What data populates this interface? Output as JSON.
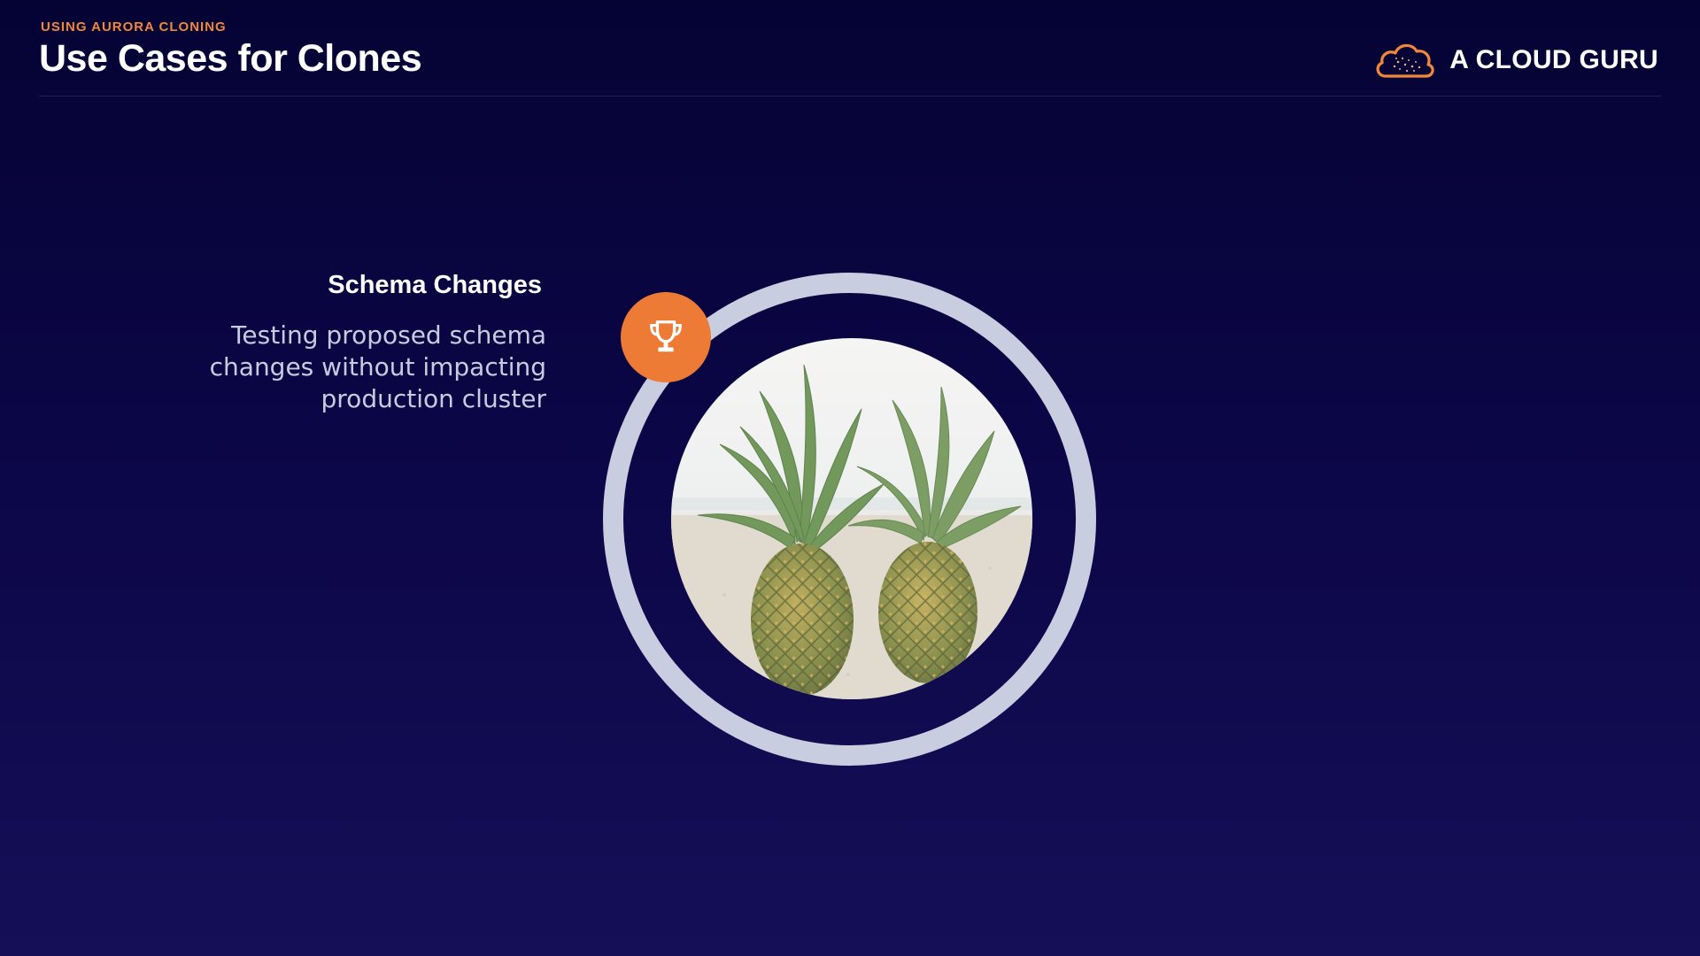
{
  "header": {
    "eyebrow": "USING AURORA CLONING",
    "title": "Use Cases for Clones"
  },
  "brand": {
    "name": "A CLOUD GURU",
    "logo_icon": "cloud-logo-icon",
    "accent_color": "#f0873c"
  },
  "feature": {
    "icon": "trophy-icon",
    "title": "Schema Changes",
    "description": "Testing proposed schema changes without impacting production cluster"
  },
  "image": {
    "subject": "two-pineapples-on-beach"
  },
  "colors": {
    "background_top": "#050334",
    "background_bottom": "#150f58",
    "ring": "#c9cde0",
    "badge": "#ee7b35"
  }
}
